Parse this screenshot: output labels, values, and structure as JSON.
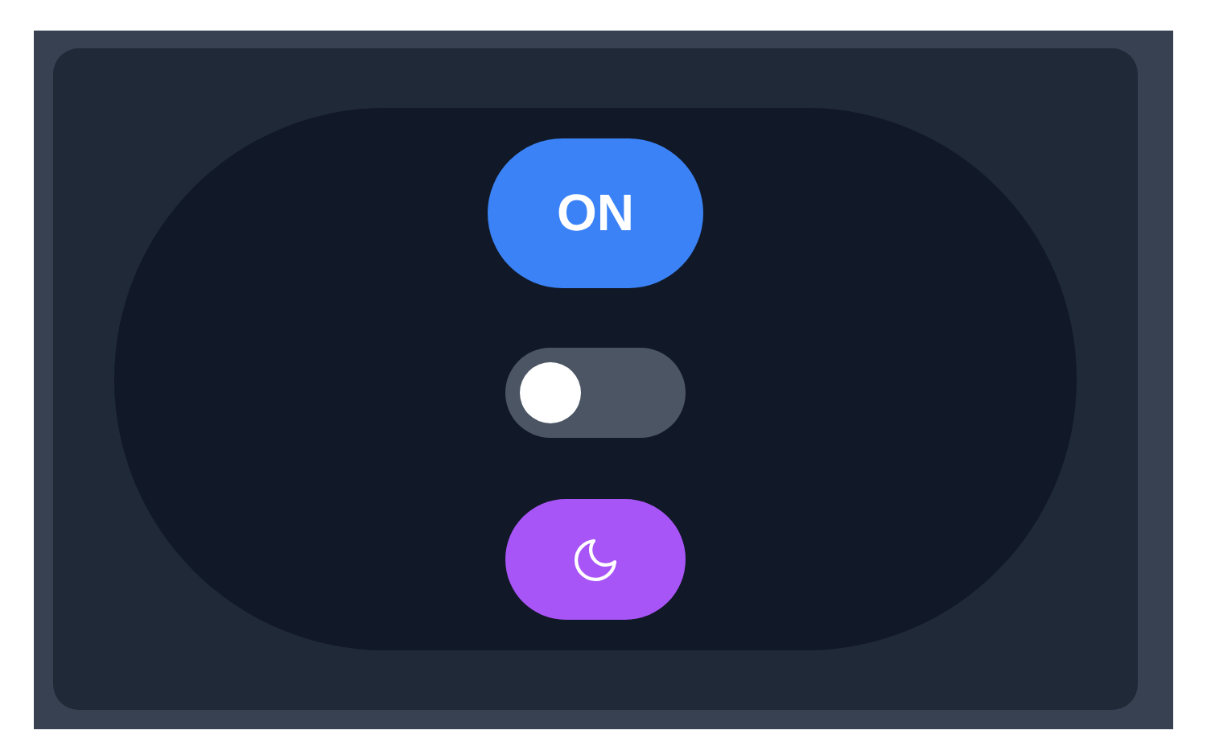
{
  "power_button": {
    "label": "ON",
    "on": true
  },
  "toggle": {
    "on": false
  },
  "theme_button": {
    "dark": true
  }
}
